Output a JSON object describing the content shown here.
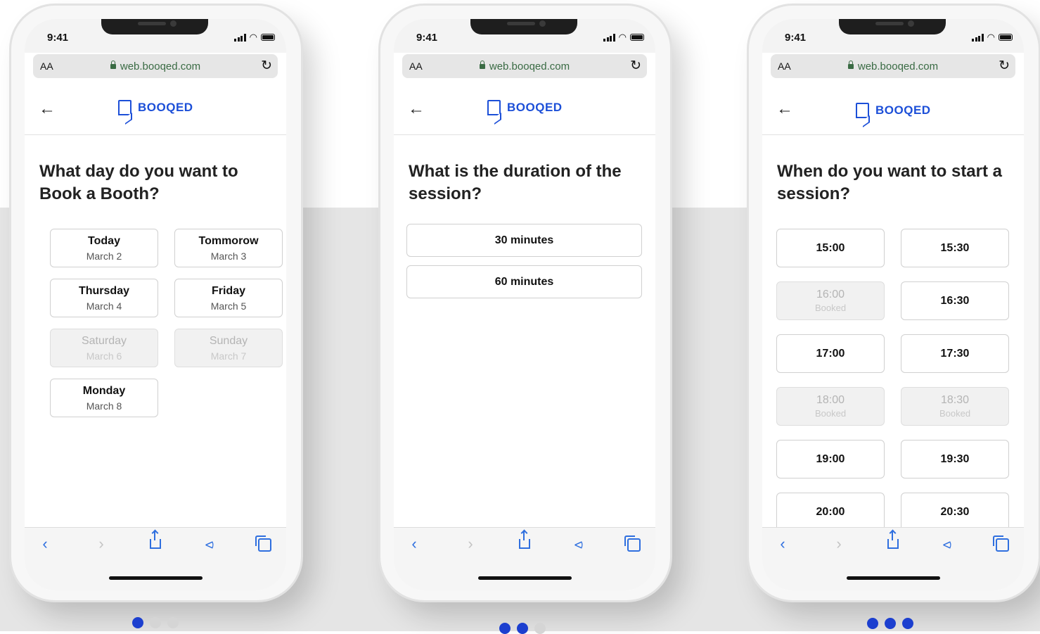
{
  "status": {
    "time": "9:41"
  },
  "browser": {
    "text_size_label": "AA",
    "url": "web.booqed.com"
  },
  "brand": {
    "name": "BOOQED",
    "primary_color": "#1c4fd8"
  },
  "screens": [
    {
      "question": "What day do you want to Book a Booth?",
      "options": [
        {
          "label": "Today",
          "sub": "March 2",
          "available": true
        },
        {
          "label": "Tommorow",
          "sub": "March 3",
          "available": true
        },
        {
          "label": "Thursday",
          "sub": "March 4",
          "available": true
        },
        {
          "label": "Friday",
          "sub": "March 5",
          "available": true
        },
        {
          "label": "Saturday",
          "sub": "March 6",
          "available": false
        },
        {
          "label": "Sunday",
          "sub": "March 7",
          "available": false
        },
        {
          "label": "Monday",
          "sub": "March 8",
          "available": true
        }
      ],
      "page_indicator": {
        "current": 1,
        "total": 3
      }
    },
    {
      "question": "What is the duration of the session?",
      "options": [
        {
          "label": "30 minutes"
        },
        {
          "label": "60 minutes"
        }
      ],
      "page_indicator": {
        "current": 2,
        "total": 3
      }
    },
    {
      "question": "When do you want to start a session?",
      "options": [
        {
          "label": "15:00",
          "sub": "",
          "available": true
        },
        {
          "label": "15:30",
          "sub": "",
          "available": true
        },
        {
          "label": "16:00",
          "sub": "Booked",
          "available": false
        },
        {
          "label": "16:30",
          "sub": "",
          "available": true
        },
        {
          "label": "17:00",
          "sub": "",
          "available": true
        },
        {
          "label": "17:30",
          "sub": "",
          "available": true
        },
        {
          "label": "18:00",
          "sub": "Booked",
          "available": false
        },
        {
          "label": "18:30",
          "sub": "Booked",
          "available": false
        },
        {
          "label": "19:00",
          "sub": "",
          "available": true
        },
        {
          "label": "19:30",
          "sub": "",
          "available": true
        },
        {
          "label": "20:00",
          "sub": "",
          "available": true
        },
        {
          "label": "20:30",
          "sub": "",
          "available": true
        }
      ],
      "page_indicator": {
        "current": 3,
        "total": 3
      }
    }
  ],
  "toolbar": {
    "buttons": [
      {
        "icon": "back-icon",
        "enabled": true
      },
      {
        "icon": "forward-icon",
        "enabled": false
      },
      {
        "icon": "share-icon",
        "enabled": true
      },
      {
        "icon": "bookmarks-icon",
        "enabled": true
      },
      {
        "icon": "tabs-icon",
        "enabled": true
      }
    ]
  },
  "colors": {
    "active_dot": "#1c3fcf",
    "inactive_dot": "#d5d5d5",
    "url_text": "#3a6b44",
    "toolbar_icon": "#2f6fdf"
  }
}
